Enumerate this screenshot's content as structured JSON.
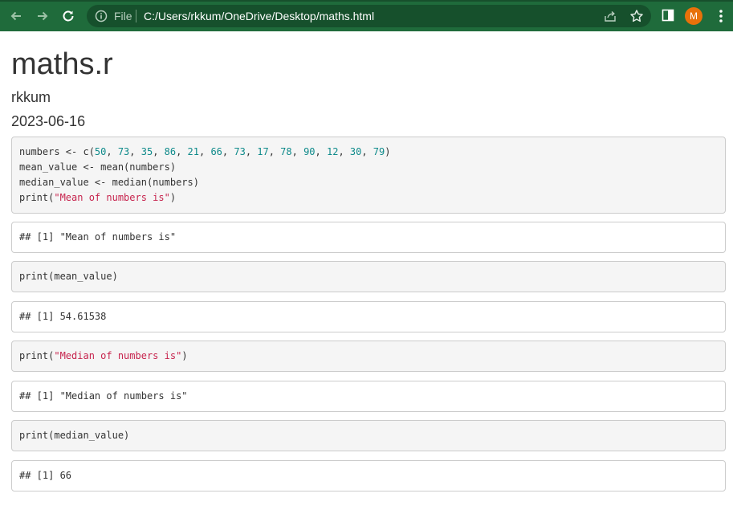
{
  "browser": {
    "omnibox": {
      "scheme_label": "File",
      "url": "C:/Users/rkkum/OneDrive/Desktop/maths.html"
    },
    "profile_initial": "M",
    "colors": {
      "toolbar": "#1f6b3b",
      "omnibox": "#16502c",
      "avatar": "#e8710a"
    }
  },
  "document": {
    "title": "maths.r",
    "author": "rkkum",
    "date": "2023-06-16"
  },
  "chunks": {
    "c1": {
      "l1_a": "numbers <- c(",
      "n1": "50",
      "n2": "73",
      "n3": "35",
      "n4": "86",
      "n5": "21",
      "n6": "66",
      "n7": "73",
      "n8": "17",
      "n9": "78",
      "n10": "90",
      "n11": "12",
      "n12": "30",
      "n13": "79",
      "l1_end": ")",
      "l2": "mean_value <- mean(numbers)",
      "l3": "median_value <- median(numbers)",
      "l4_a": "print(",
      "l4_str": "\"Mean of numbers is\"",
      "l4_end": ")"
    },
    "o1": "## [1] \"Mean of numbers is\"",
    "c2": "print(mean_value)",
    "o2": "## [1] 54.61538",
    "c3": {
      "a": "print(",
      "str": "\"Median of numbers is\"",
      "end": ")"
    },
    "o3": "## [1] \"Median of numbers is\"",
    "c4": "print(median_value)",
    "o4": "## [1] 66"
  }
}
